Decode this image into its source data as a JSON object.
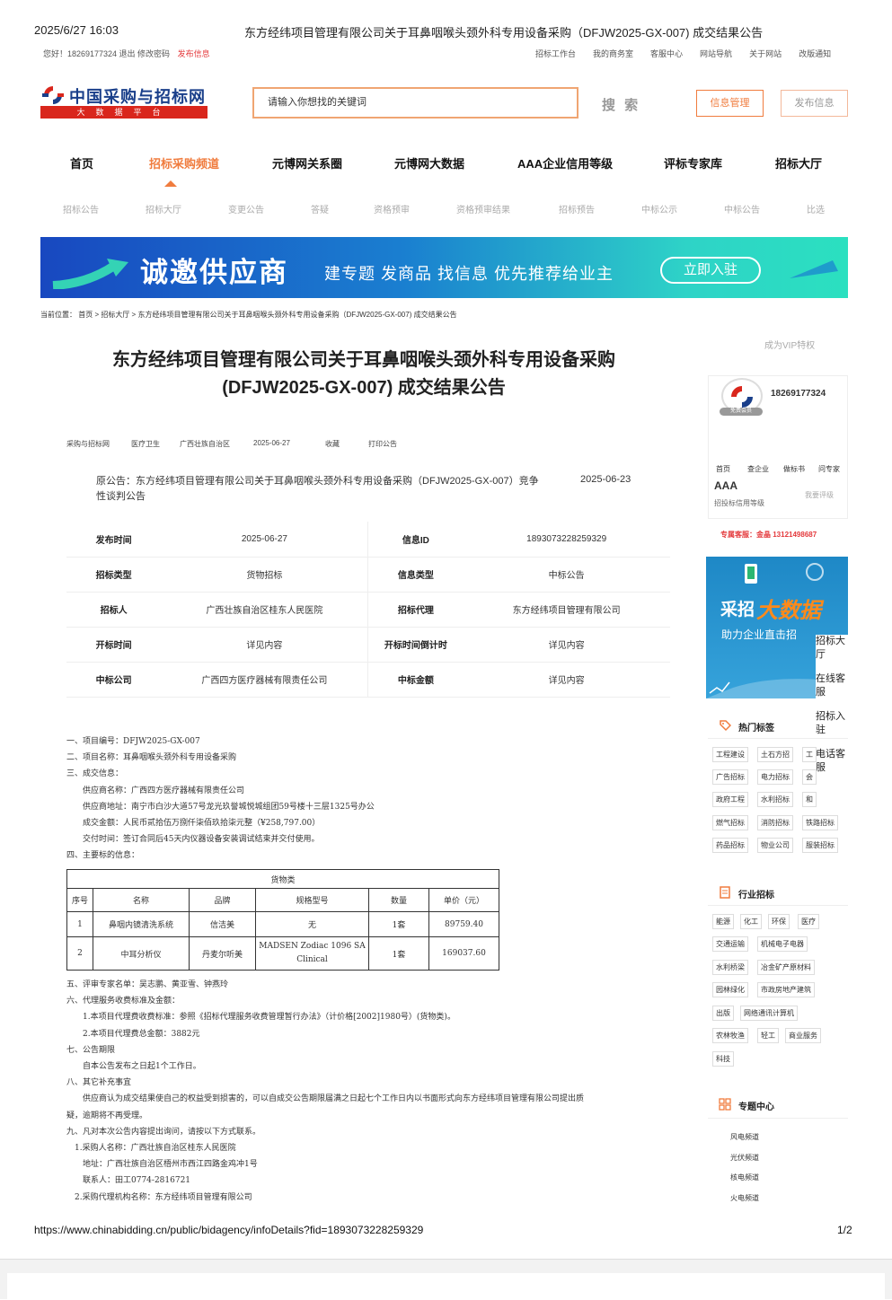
{
  "print_header": {
    "datetime": "2025/6/27 16:03",
    "title": "东方经纬项目管理有限公司关于耳鼻咽喉头颈外科专用设备采购（DFJW2025-GX-007) 成交结果公告"
  },
  "topbar": {
    "greeting": "您好！18269177324 退出 修改密码",
    "publish": "发布信息",
    "links": [
      "招标工作台",
      "我的商务室",
      "客服中心",
      "网站导航",
      "关于网站",
      "改版通知"
    ]
  },
  "logo": {
    "name": "中国采购与招标网",
    "sub": "大数据平台"
  },
  "search": {
    "placeholder": "请输入你想找的关键词",
    "button": "搜 索"
  },
  "header_buttons": {
    "info_manage": "信息管理",
    "publish": "发布信息"
  },
  "nav": [
    "首页",
    "招标采购频道",
    "元博网关系圈",
    "元博网大数据",
    "AAA企业信用等级",
    "评标专家库",
    "招标大厅"
  ],
  "subnav": [
    "招标公告",
    "招标大厅",
    "变更公告",
    "答疑",
    "资格预审",
    "资格预审结果",
    "招标预告",
    "中标公示",
    "中标公告",
    "比选"
  ],
  "banner": {
    "title": "诚邀供应商",
    "subtitle": "建专题 发商品 找信息 优先推荐给业主",
    "button": "立即入驻"
  },
  "breadcrumb": "当前位置： 首页 > 招标大厅 > 东方经纬项目管理有限公司关于耳鼻咽喉头颈外科专用设备采购（DFJW2025-GX-007) 成交结果公告",
  "article": {
    "title_line1": "东方经纬项目管理有限公司关于耳鼻咽喉头颈外科专用设备采购",
    "title_line2": "(DFJW2025-GX-007) 成交结果公告",
    "meta": [
      "采购与招标网",
      "医疗卫生",
      "广西壮族自治区",
      "2025-06-27",
      "收藏",
      "打印公告"
    ],
    "original": "原公告：东方经纬项目管理有限公司关于耳鼻咽喉头颈外科专用设备采购（DFJW2025-GX-007）竞争性谈判公告",
    "original_date": "2025-06-23",
    "info_rows": [
      {
        "k1": "发布时间",
        "v1": "2025-06-27",
        "k2": "信息ID",
        "v2": "1893073228259329"
      },
      {
        "k1": "招标类型",
        "v1": "货物招标",
        "k2": "信息类型",
        "v2": "中标公告"
      },
      {
        "k1": "招标人",
        "v1": "广西壮族自治区桂东人民医院",
        "k2": "招标代理",
        "v2": "东方经纬项目管理有限公司"
      },
      {
        "k1": "开标时间",
        "v1": "详见内容",
        "k2": "开标时间倒计时",
        "v2": "详见内容"
      },
      {
        "k1": "中标公司",
        "v1": "广西四方医疗器械有限责任公司",
        "k2": "中标金额",
        "v2": "详见内容"
      }
    ],
    "body_top": [
      "一、项目编号：DFJW2025-GX-007",
      "二、项目名称：耳鼻咽喉头颈外科专用设备采购",
      "三、成交信息：",
      "　　供应商名称：广西四方医疗器械有限责任公司",
      "　　供应商地址：南宁市白沙大道57号龙光玖誉城悦城组团59号楼十三层1325号办公",
      "　　成交金额：人民币贰拾伍万捌仟柒佰玖拾柒元整（¥258,797.00）",
      "　　交付时间：签订合同后45天内仪器设备安装调试结束并交付使用。",
      "四、主要标的信息："
    ],
    "goods": {
      "caption": "货物类",
      "headers": [
        "序号",
        "名称",
        "品牌",
        "规格型号",
        "数量",
        "单价（元）"
      ],
      "rows": [
        [
          "1",
          "鼻咽内镜清洗系统",
          "信洁美",
          "无",
          "1套",
          "89759.40"
        ],
        [
          "2",
          "中耳分析仪",
          "丹麦尔听美",
          "MADSEN Zodiac 1096 SA Clinical",
          "1套",
          "169037.60"
        ]
      ]
    },
    "body_bottom": [
      "五、评审专家名单：吴志鹏、黄亚雪、钟燕玲",
      "六、代理服务收费标准及金额：",
      "　　1.本项目代理费收费标准：参照《招标代理服务收费管理暂行办法》（计价格[2002]1980号）(货物类)。",
      "　　2.本项目代理费总金额：3882元",
      "七、公告期限",
      "　　自本公告发布之日起1个工作日。",
      "八、其它补充事宜",
      "　　供应商认为成交结果使自己的权益受到损害的，可以自成交公告期限届满之日起七个工作日内以书面形式向东方经纬项目管理有限公司提出质",
      "疑，逾期将不再受理。",
      "九、凡对本次公告内容提出询问，请按以下方式联系。",
      "　1.采购人名称：广西壮族自治区桂东人民医院",
      "　　地址：广西壮族自治区梧州市西江四路金鸡冲1号",
      "　　联系人：田工0774-2816721",
      "　2.采购代理机构名称：东方经纬项目管理有限公司"
    ]
  },
  "sidebar": {
    "vip": "成为VIP特权",
    "phone": "18269177324",
    "tag": "免费会员",
    "links": [
      "首页",
      "查企业",
      "做标书",
      "问专家"
    ],
    "rating": "AAA",
    "rating_label": "招投标信用等级",
    "rate_link": "我要评级",
    "hotline": "专属客服：金晶 13121498687",
    "ad_t1": "采招",
    "ad_t2": "大数据",
    "ad_t3": "助力企业直击招",
    "float": [
      "招标大厅",
      "在线客服",
      "招标入驻",
      "电话客服"
    ],
    "hot_title": "热门标签",
    "hot_tags": [
      "工程建设",
      "土石方招",
      "工",
      "广告招标",
      "电力招标",
      "会",
      "政府工程",
      "水利招标",
      "和",
      "燃气招标",
      "消防招标",
      "铁路招标",
      "药品招标",
      "物业公司",
      "服装招标"
    ],
    "industry_title": "行业招标",
    "industry_tags": [
      "能源",
      "化工",
      "环保",
      "医疗",
      "交通运输",
      "机械电子电器",
      "水利桥梁",
      "冶金矿产原材料",
      "园林绿化",
      "市政房地产建筑",
      "出版",
      "网络通讯计算机",
      "农林牧渔",
      "轻工",
      "商业服务",
      "科技"
    ],
    "topic_title": "专题中心",
    "topics": [
      "风电频道",
      "光伏频道",
      "核电频道",
      "火电频道"
    ]
  },
  "print_footer": {
    "url": "https://www.chinabidding.cn/public/bidagency/infoDetails?fid=1893073228259329",
    "page": "1/2"
  },
  "colors": {
    "accent": "#f07c3e",
    "red": "#e4393c",
    "brand_blue": "#1a3f8a"
  }
}
